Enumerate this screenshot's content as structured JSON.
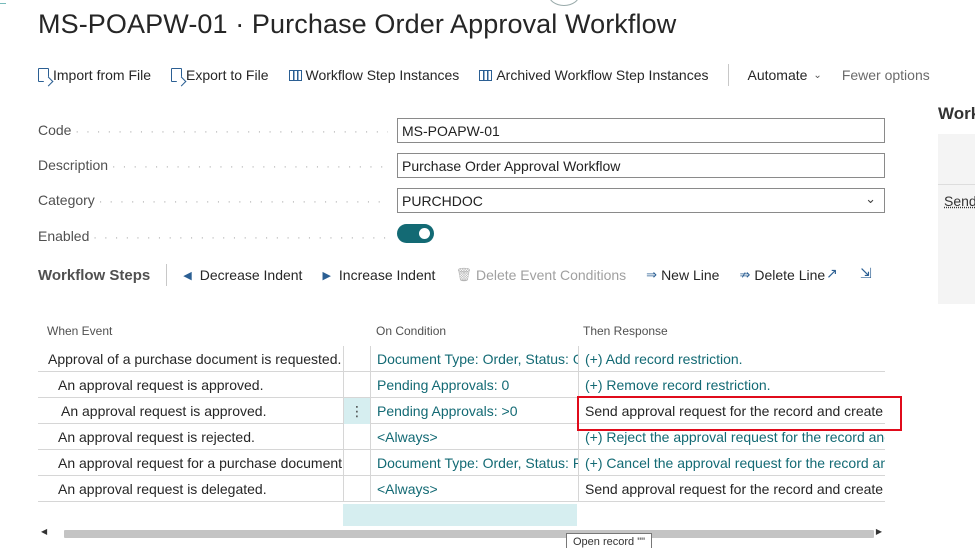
{
  "page": {
    "title": "MS-POAPW-01 · Purchase Order Approval Workflow"
  },
  "actions": {
    "import_from_file": "Import from File",
    "export_to_file": "Export to File",
    "workflow_step_instances": "Workflow Step Instances",
    "archived_workflow_step_instances": "Archived Workflow Step Instances",
    "automate": "Automate",
    "fewer_options": "Fewer options"
  },
  "fields": {
    "code": {
      "label": "Code",
      "value": "MS-POAPW-01"
    },
    "description": {
      "label": "Description",
      "value": "Purchase Order Approval Workflow"
    },
    "category": {
      "label": "Category",
      "value": "PURCHDOC"
    },
    "enabled": {
      "label": "Enabled",
      "value": true
    }
  },
  "steps_part": {
    "title": "Workflow Steps",
    "decrease_indent": "Decrease Indent",
    "increase_indent": "Increase Indent",
    "delete_event_conditions": "Delete Event Conditions",
    "new_line": "New Line",
    "delete_line": "Delete Line"
  },
  "grid": {
    "columns": [
      "When Event",
      "On Condition",
      "Then Response"
    ],
    "rows": [
      {
        "event": "Approval of a purchase document is requested.",
        "condition": "Document Type: Order, Status: O...",
        "response": "(+) Add record restriction."
      },
      {
        "event": "An approval request is approved.",
        "condition": "Pending Approvals: 0",
        "response": "(+) Remove record restriction."
      },
      {
        "event": "An approval request is approved.",
        "condition": "Pending Approvals: >0",
        "response": "Send approval request for the record and create a nc"
      },
      {
        "event": "An approval request is rejected.",
        "condition": "<Always>",
        "response": "(+) Reject the approval request for the record and cr"
      },
      {
        "event": "An approval request for a purchase document i...",
        "condition": "Document Type: Order, Status: P...",
        "response": "(+) Cancel the approval request for the record and cr"
      },
      {
        "event": "An approval request is delegated.",
        "condition": "<Always>",
        "response": "Send approval request for the record and create a nc"
      }
    ],
    "tooltip": "Open record \"\""
  },
  "factbox": {
    "title": "Work",
    "item": "Send"
  },
  "colors": {
    "link_teal": "#136a74",
    "action_blue": "#2b5f93",
    "highlight_red": "#e00b1b",
    "selected_cyan": "#d6eef0"
  }
}
